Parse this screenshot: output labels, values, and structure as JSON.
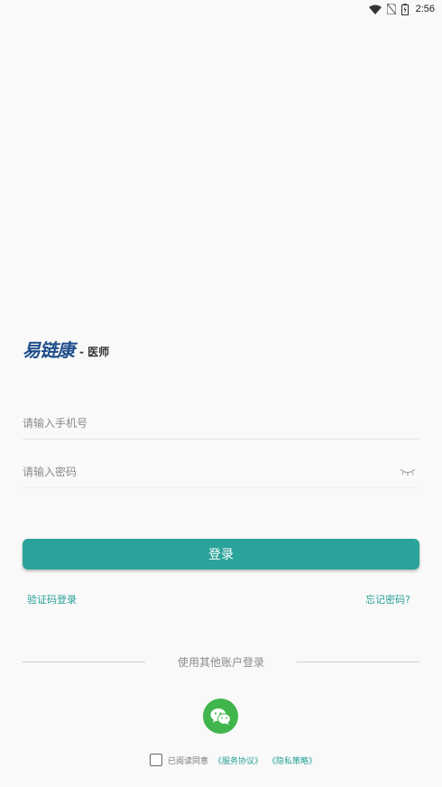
{
  "status_bar": {
    "time": "2:56",
    "icons": [
      "wifi-icon",
      "no-sim-icon",
      "battery-icon"
    ]
  },
  "brand": {
    "logo_text": "易链康",
    "suffix": "- 医师"
  },
  "form": {
    "phone_placeholder": "请输入手机号",
    "password_placeholder": "请输入密码",
    "login_label": "登录"
  },
  "links": {
    "sms_login": "验证码登录",
    "forgot_password": "忘记密码?"
  },
  "third_party": {
    "label": "使用其他账户登录",
    "wechat_icon": "wechat-icon"
  },
  "agreement": {
    "prefix": "已阅读同意",
    "service": "《服务协议》",
    "privacy": "《隐私策略》",
    "checked": false
  },
  "colors": {
    "accent": "#2aa39a",
    "link": "#26a096",
    "brand": "#1f4e8a",
    "wechat": "#3fb54b",
    "background": "#f9f9f9"
  }
}
